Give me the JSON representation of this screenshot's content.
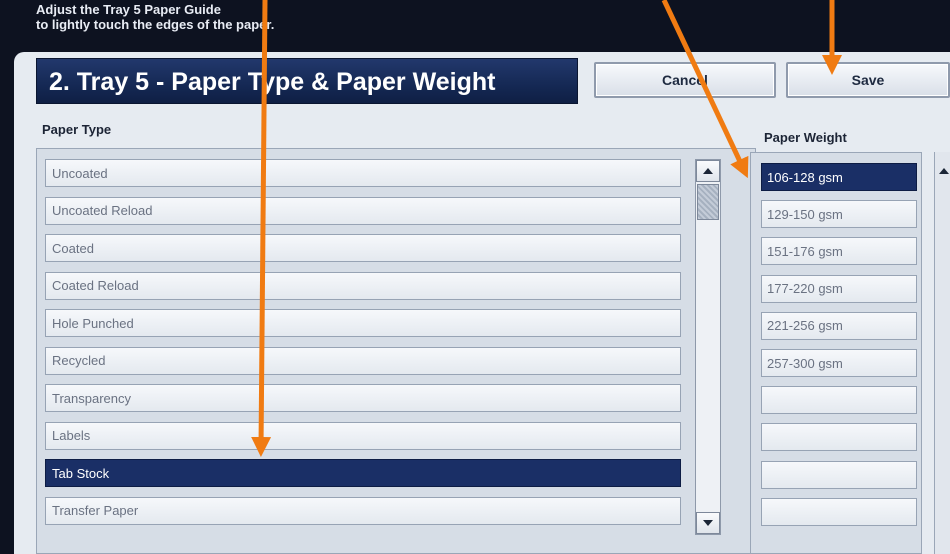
{
  "instruction": {
    "line1": "Adjust the Tray 5 Paper Guide",
    "line2": "to lightly touch the edges of the paper."
  },
  "header": {
    "title": "2. Tray 5 - Paper Type & Paper Weight",
    "cancel_label": "Cancel",
    "save_label": "Save"
  },
  "paper_type": {
    "label": "Paper Type",
    "items": [
      {
        "label": "Uncoated",
        "selected": false
      },
      {
        "label": "Uncoated Reload",
        "selected": false
      },
      {
        "label": "Coated",
        "selected": false
      },
      {
        "label": "Coated Reload",
        "selected": false
      },
      {
        "label": "Hole Punched",
        "selected": false
      },
      {
        "label": "Recycled",
        "selected": false
      },
      {
        "label": "Transparency",
        "selected": false
      },
      {
        "label": "Labels",
        "selected": false
      },
      {
        "label": "Tab Stock",
        "selected": true
      },
      {
        "label": "Transfer Paper",
        "selected": false
      }
    ]
  },
  "paper_weight": {
    "label": "Paper Weight",
    "items": [
      {
        "label": "106-128 gsm",
        "selected": true
      },
      {
        "label": "129-150 gsm",
        "selected": false
      },
      {
        "label": "151-176 gsm",
        "selected": false
      },
      {
        "label": "177-220 gsm",
        "selected": false
      },
      {
        "label": "221-256 gsm",
        "selected": false
      },
      {
        "label": "257-300 gsm",
        "selected": false
      },
      {
        "label": "",
        "selected": false
      },
      {
        "label": "",
        "selected": false
      },
      {
        "label": "",
        "selected": false
      },
      {
        "label": "",
        "selected": false
      }
    ]
  },
  "icons": {
    "scroll_up": "triangle-up-icon",
    "scroll_down": "triangle-down-icon",
    "annotation": "orange-arrow-icon"
  },
  "colors": {
    "selected_bg": "#1a2f66",
    "title_bg": "#132650",
    "annotation_arrow": "#f07b12"
  }
}
